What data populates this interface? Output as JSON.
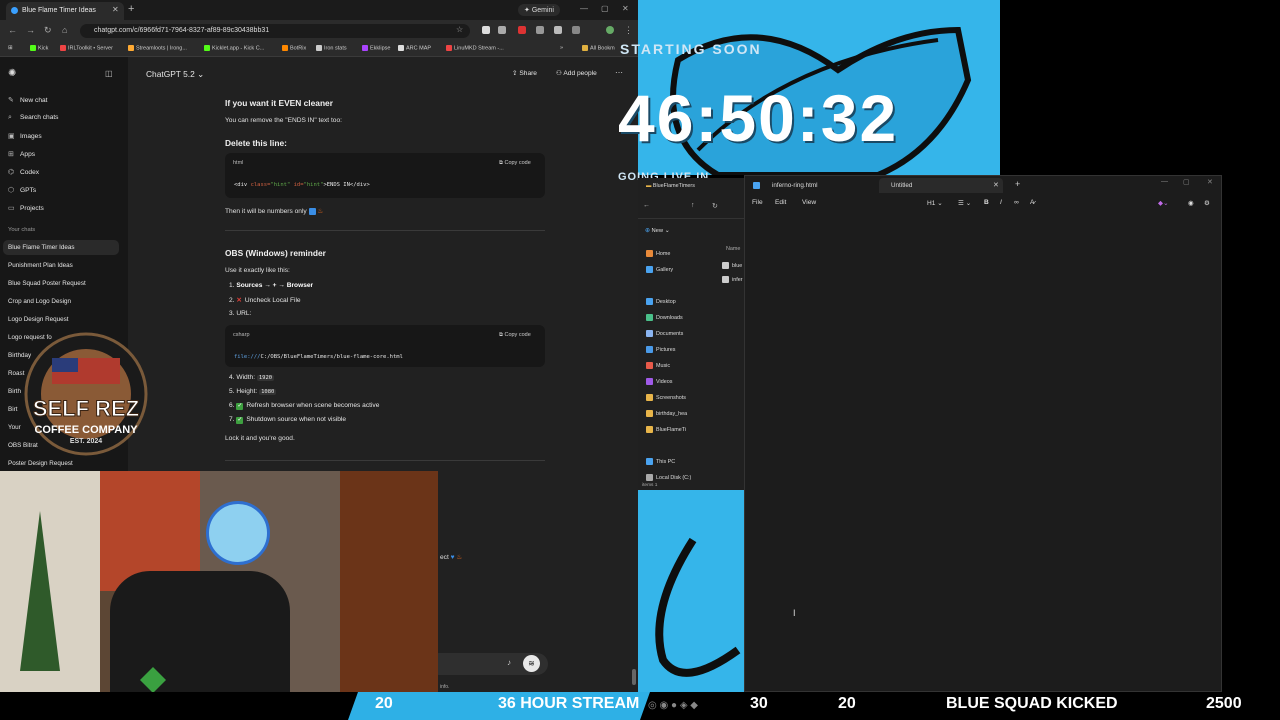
{
  "browser": {
    "tab_title": "Blue Flame Timer Ideas",
    "gemini_label": "Gemini",
    "url": "chatgpt.com/c/6966fd71-7964-8327-af89-89c30438bb31",
    "bookmarks": [
      "Kick",
      "IRLToolkit • Server",
      "Streamloots | Irong...",
      "Kicklet.app - Kick C...",
      "BotRix",
      "Iron stats",
      "Ekklipse",
      "ARC MAP",
      "LinuMKD Stream -..."
    ],
    "all_bookmarks": "All Bookm"
  },
  "sidebar": {
    "items": [
      {
        "icon": "new-chat-icon",
        "label": "New chat"
      },
      {
        "icon": "search-icon",
        "label": "Search chats"
      },
      {
        "icon": "images-icon",
        "label": "Images"
      },
      {
        "icon": "apps-icon",
        "label": "Apps"
      },
      {
        "icon": "codex-icon",
        "label": "Codex"
      },
      {
        "icon": "gpts-icon",
        "label": "GPTs"
      },
      {
        "icon": "projects-icon",
        "label": "Projects"
      }
    ],
    "section_label": "Your chats",
    "chats": [
      "Blue Flame Timer Ideas",
      "Punishment Plan Ideas",
      "Blue Squad Poster Request",
      "Crop and Logo Design",
      "Logo Design Request",
      "Logo request fo",
      "Birthday",
      "Roast",
      "Birth",
      "Birt",
      "Your",
      "OBS Bitrat",
      "Poster Design Request"
    ]
  },
  "header": {
    "model": "ChatGPT 5.2",
    "share": "Share",
    "add_people": "Add people"
  },
  "content": {
    "h1": "If you want it EVEN cleaner",
    "p1": "You can remove the \"ENDS IN\" text too:",
    "h2": "Delete this line:",
    "code1_lang": "html",
    "copy_label": "Copy code",
    "code1_a": "<div ",
    "code1_b": "class=",
    "code1_c": "\"hint\" ",
    "code1_d": "id=",
    "code1_e": "\"hint\"",
    "code1_f": ">ENDS IN</div>",
    "p2": "Then it will be numbers only",
    "h3": "OBS (Windows) reminder",
    "p3": "Use it exactly like this:",
    "steps": [
      {
        "num": "1.",
        "text": "Sources → + → Browser"
      },
      {
        "num": "2.",
        "text": "Uncheck Local File"
      },
      {
        "num": "3.",
        "text": "URL:"
      },
      {
        "num": "4.",
        "text": "Width:",
        "code": "1920"
      },
      {
        "num": "5.",
        "text": "Height:",
        "code": "1080"
      },
      {
        "num": "6.",
        "text": "Refresh browser when scene becomes active"
      },
      {
        "num": "7.",
        "text": "Shutdown source when not visible"
      }
    ],
    "code2_lang": "csharp",
    "code2_a": "file:///",
    "code2_b": "C:/OBS/BlueFlameTimers/blue-flame-core.html",
    "p4": "Lock it and you're good.",
    "partial_text": "ect",
    "footer_note": "info."
  },
  "overlay": {
    "starting_soon": "STARTING SOON",
    "timer": "46:50:32",
    "going_live": "GOING LIVE IN"
  },
  "explorer": {
    "path": "BlueFlameTimers",
    "new_label": "New",
    "column_name": "Name",
    "files": [
      "blue",
      "infer"
    ],
    "nav": [
      "Home",
      "Gallery",
      "Desktop",
      "Downloads",
      "Documents",
      "Pictures",
      "Music",
      "Videos",
      "Screenshots",
      "birthday_hea",
      "BlueFlameTi",
      "This PC",
      "Local Disk (C:)"
    ],
    "status": "items   1"
  },
  "notepad": {
    "tab1": "inferno-ring.html",
    "tab2": "Untitled",
    "menu": [
      "File",
      "Edit",
      "View"
    ],
    "heading_select": "H1"
  },
  "logo": {
    "arc_text": "LIFE IS TOO SHORT TO DRINK BAD COFFEE",
    "line1": "SELF REZ",
    "line2": "COFFEE COMPANY",
    "line3": "EST. 2024"
  },
  "ticker": {
    "n1": "20",
    "stream": "36 HOUR STREAM",
    "n2": "30",
    "n3": "20",
    "kicked": "BLUE SQUAD KICKED",
    "n4": "2500"
  },
  "colors": {
    "accent_blue": "#35b5ea",
    "chatgpt_bg": "#212121",
    "sidebar_bg": "#171717"
  }
}
